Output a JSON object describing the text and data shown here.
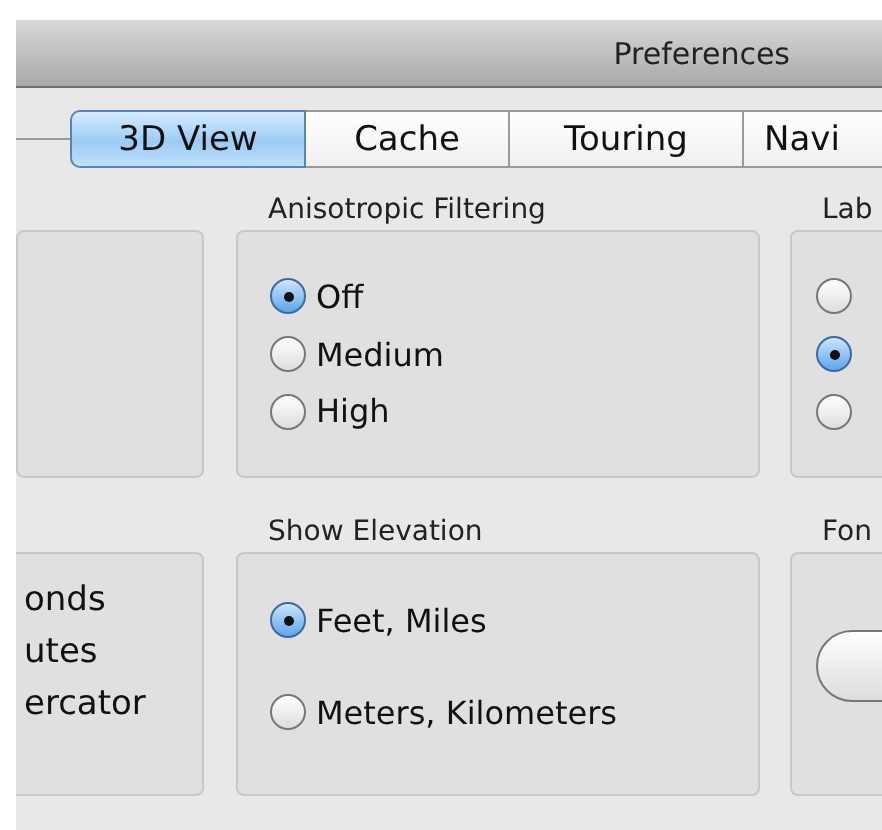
{
  "window": {
    "title": "Preferences"
  },
  "tabs": [
    {
      "label": "3D View",
      "selected": true
    },
    {
      "label": "Cache",
      "selected": false
    },
    {
      "label": "Touring",
      "selected": false
    },
    {
      "label": "Navi",
      "selected": false
    }
  ],
  "rows": [
    {
      "groups": [
        {
          "kind": "blank"
        },
        {
          "kind": "radios",
          "title": "Anisotropic Filtering",
          "options": [
            {
              "label": "Off",
              "selected": true
            },
            {
              "label": "Medium",
              "selected": false
            },
            {
              "label": "High",
              "selected": false
            }
          ]
        },
        {
          "kind": "radios",
          "title": "Lab",
          "options": [
            {
              "selected": false
            },
            {
              "selected": true
            },
            {
              "selected": false
            }
          ]
        }
      ]
    },
    {
      "groups": [
        {
          "kind": "lines",
          "lines": [
            "onds",
            "utes",
            "ercator"
          ]
        },
        {
          "kind": "radios",
          "title": "Show Elevation",
          "options": [
            {
              "label": "Feet, Miles",
              "selected": true
            },
            {
              "label": "Meters, Kilometers",
              "selected": false
            }
          ]
        },
        {
          "kind": "button",
          "title": "Fon"
        }
      ]
    }
  ]
}
